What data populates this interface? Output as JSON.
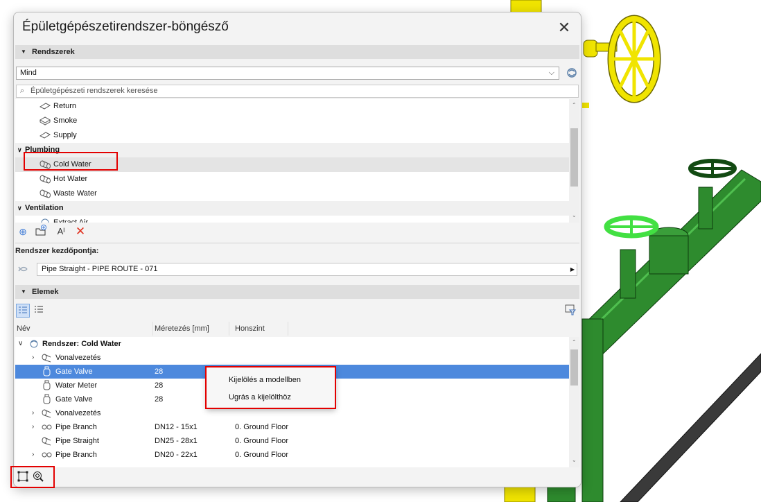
{
  "dialog": {
    "title": "Épületgépészetirendszer-böngésző",
    "close_glyph": "✕"
  },
  "systems_section": {
    "header": "Rendszerek",
    "filter_value": "Mind",
    "search_placeholder": "Épületgépészeti rendszerek keresése",
    "rows": [
      {
        "label": "Return",
        "icon": "duct-icon",
        "type": "item"
      },
      {
        "label": "Smoke",
        "icon": "duct-box-icon",
        "type": "item"
      },
      {
        "label": "Supply",
        "icon": "duct-icon",
        "type": "item"
      },
      {
        "label": "Plumbing",
        "type": "group"
      },
      {
        "label": "Cold Water",
        "icon": "pipe-icon",
        "type": "item",
        "selected": true
      },
      {
        "label": "Hot Water",
        "icon": "pipe-icon",
        "type": "item"
      },
      {
        "label": "Waste Water",
        "icon": "pipe-icon",
        "type": "item"
      },
      {
        "label": "Ventilation",
        "type": "group"
      },
      {
        "label": "Extract Air",
        "icon": "system-icon",
        "type": "item"
      }
    ]
  },
  "start_point": {
    "label": "Rendszer kezdőpontja:",
    "value": "Pipe Straight - PIPE ROUTE - 071"
  },
  "elements_section": {
    "header": "Elemek",
    "columns": [
      "Név",
      "Méretezés [mm]",
      "Honszint"
    ],
    "rows": [
      {
        "name": "Rendszer: Cold Water",
        "size": "",
        "level": "",
        "bold": true,
        "expand": "v",
        "indent": 0
      },
      {
        "name": "Vonalvezetés",
        "size": "",
        "level": "",
        "expand": ">",
        "indent": 1
      },
      {
        "name": "Gate Valve",
        "size": "28",
        "level": "",
        "indent": 1,
        "selected": true
      },
      {
        "name": "Water Meter",
        "size": "28",
        "level": "",
        "indent": 1
      },
      {
        "name": "Gate Valve",
        "size": "28",
        "level": "",
        "indent": 1
      },
      {
        "name": "Vonalvezetés",
        "size": "",
        "level": "",
        "expand": ">",
        "indent": 1
      },
      {
        "name": "Pipe Branch",
        "size": "DN12 - 15x1",
        "level": "0. Ground Floor",
        "expand": ">",
        "indent": 1
      },
      {
        "name": "Pipe Straight",
        "size": "DN25 - 28x1",
        "level": "0. Ground Floor",
        "indent": 1
      },
      {
        "name": "Pipe Branch",
        "size": "DN20 - 22x1",
        "level": "0. Ground Floor",
        "expand": ">",
        "indent": 1
      }
    ]
  },
  "context_menu": {
    "items": [
      "Kijelölés a modellben",
      "Ugrás a kijelölthöz"
    ]
  },
  "colors": {
    "selection": "#4d89dd",
    "highlight_box": "#e30000",
    "pipe_green": "#2e8b2e",
    "valve_yellow": "#f0e400"
  }
}
